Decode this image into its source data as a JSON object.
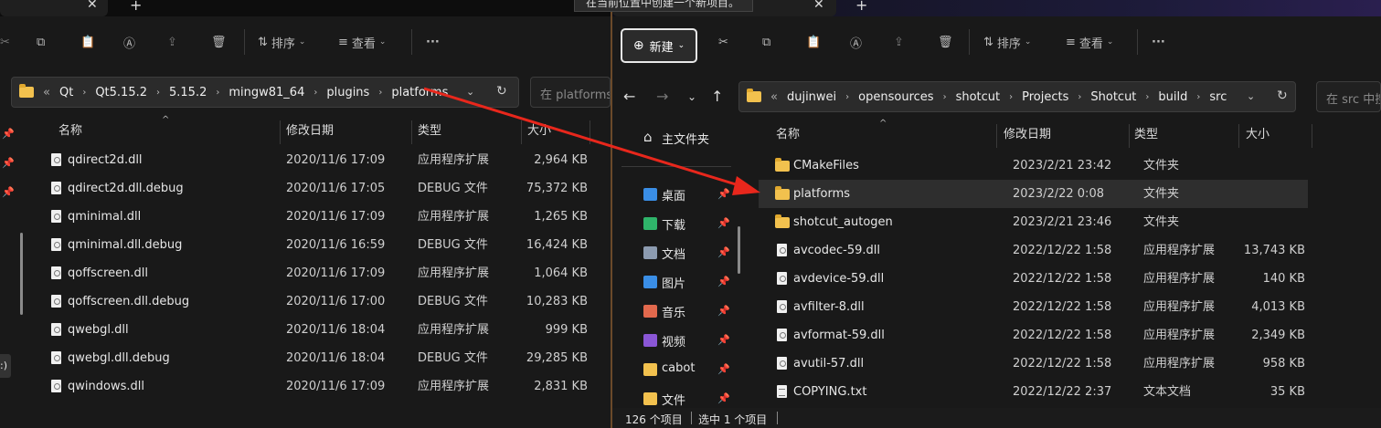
{
  "left": {
    "toolbar": {
      "sort_label": "排序",
      "view_label": "查看",
      "more_label": "···"
    },
    "address": {
      "crumbs": [
        "Qt",
        "Qt5.15.2",
        "5.15.2",
        "mingw81_64",
        "plugins",
        "platforms"
      ],
      "overflow": "«"
    },
    "search_placeholder": "在 platforms 中搜索",
    "headers": {
      "name": "名称",
      "date": "修改日期",
      "type": "类型",
      "size": "大小"
    },
    "files": [
      {
        "name": "qdirect2d.dll",
        "date": "2020/11/6 17:09",
        "type": "应用程序扩展",
        "size": "2,964 KB"
      },
      {
        "name": "qdirect2d.dll.debug",
        "date": "2020/11/6 17:05",
        "type": "DEBUG 文件",
        "size": "75,372 KB"
      },
      {
        "name": "qminimal.dll",
        "date": "2020/11/6 17:09",
        "type": "应用程序扩展",
        "size": "1,265 KB"
      },
      {
        "name": "qminimal.dll.debug",
        "date": "2020/11/6 16:59",
        "type": "DEBUG 文件",
        "size": "16,424 KB"
      },
      {
        "name": "qoffscreen.dll",
        "date": "2020/11/6 17:09",
        "type": "应用程序扩展",
        "size": "1,064 KB"
      },
      {
        "name": "qoffscreen.dll.debug",
        "date": "2020/11/6 17:00",
        "type": "DEBUG 文件",
        "size": "10,283 KB"
      },
      {
        "name": "qwebgl.dll",
        "date": "2020/11/6 18:04",
        "type": "应用程序扩展",
        "size": "999 KB"
      },
      {
        "name": "qwebgl.dll.debug",
        "date": "2020/11/6 18:04",
        "type": "DEBUG 文件",
        "size": "29,285 KB"
      },
      {
        "name": "qwindows.dll",
        "date": "2020/11/6 17:09",
        "type": "应用程序扩展",
        "size": "2,831 KB"
      }
    ],
    "edge_label": ":)"
  },
  "tooltip": "在当前位置中创建一个新项目。",
  "right": {
    "toolbar": {
      "new_label": "新建",
      "sort_label": "排序",
      "view_label": "查看",
      "more_label": "···"
    },
    "address": {
      "crumbs": [
        "dujinwei",
        "opensources",
        "shotcut",
        "Projects",
        "Shotcut",
        "build",
        "src"
      ],
      "overflow": "«"
    },
    "search_placeholder": "在 src 中搜索",
    "nav": {
      "home": "主文件夹",
      "items": [
        {
          "label": "桌面",
          "icon": "desktop-icon",
          "color": "#3a8ee6"
        },
        {
          "label": "下载",
          "icon": "download-icon",
          "color": "#2fb46a"
        },
        {
          "label": "文档",
          "icon": "document-icon",
          "color": "#8c9bb0"
        },
        {
          "label": "图片",
          "icon": "pictures-icon",
          "color": "#3a8ee6"
        },
        {
          "label": "音乐",
          "icon": "music-icon",
          "color": "#e2694d"
        },
        {
          "label": "视频",
          "icon": "video-icon",
          "color": "#8a56d6"
        },
        {
          "label": "cabot",
          "icon": "folder-icon",
          "color": "#f2c14e"
        },
        {
          "label": "文件",
          "icon": "folder-icon",
          "color": "#f2c14e"
        }
      ]
    },
    "headers": {
      "name": "名称",
      "date": "修改日期",
      "type": "类型",
      "size": "大小"
    },
    "files": [
      {
        "name": "CMakeFiles",
        "date": "2023/2/21 23:42",
        "type": "文件夹",
        "size": "",
        "kind": "folder"
      },
      {
        "name": "platforms",
        "date": "2023/2/22 0:08",
        "type": "文件夹",
        "size": "",
        "kind": "folder",
        "selected": true
      },
      {
        "name": "shotcut_autogen",
        "date": "2023/2/21 23:46",
        "type": "文件夹",
        "size": "",
        "kind": "folder"
      },
      {
        "name": "avcodec-59.dll",
        "date": "2022/12/22 1:58",
        "type": "应用程序扩展",
        "size": "13,743 KB",
        "kind": "dll"
      },
      {
        "name": "avdevice-59.dll",
        "date": "2022/12/22 1:58",
        "type": "应用程序扩展",
        "size": "140 KB",
        "kind": "dll"
      },
      {
        "name": "avfilter-8.dll",
        "date": "2022/12/22 1:58",
        "type": "应用程序扩展",
        "size": "4,013 KB",
        "kind": "dll"
      },
      {
        "name": "avformat-59.dll",
        "date": "2022/12/22 1:58",
        "type": "应用程序扩展",
        "size": "2,349 KB",
        "kind": "dll"
      },
      {
        "name": "avutil-57.dll",
        "date": "2022/12/22 1:58",
        "type": "应用程序扩展",
        "size": "958 KB",
        "kind": "dll"
      },
      {
        "name": "COPYING.txt",
        "date": "2022/12/22 2:37",
        "type": "文本文档",
        "size": "35 KB",
        "kind": "txt"
      }
    ],
    "status": {
      "count": "126 个项目",
      "selected": "选中 1 个项目"
    }
  },
  "colors": {
    "arrow": "#e8271c",
    "folder": "#f2c14e",
    "selection": "#2e2e2e"
  }
}
